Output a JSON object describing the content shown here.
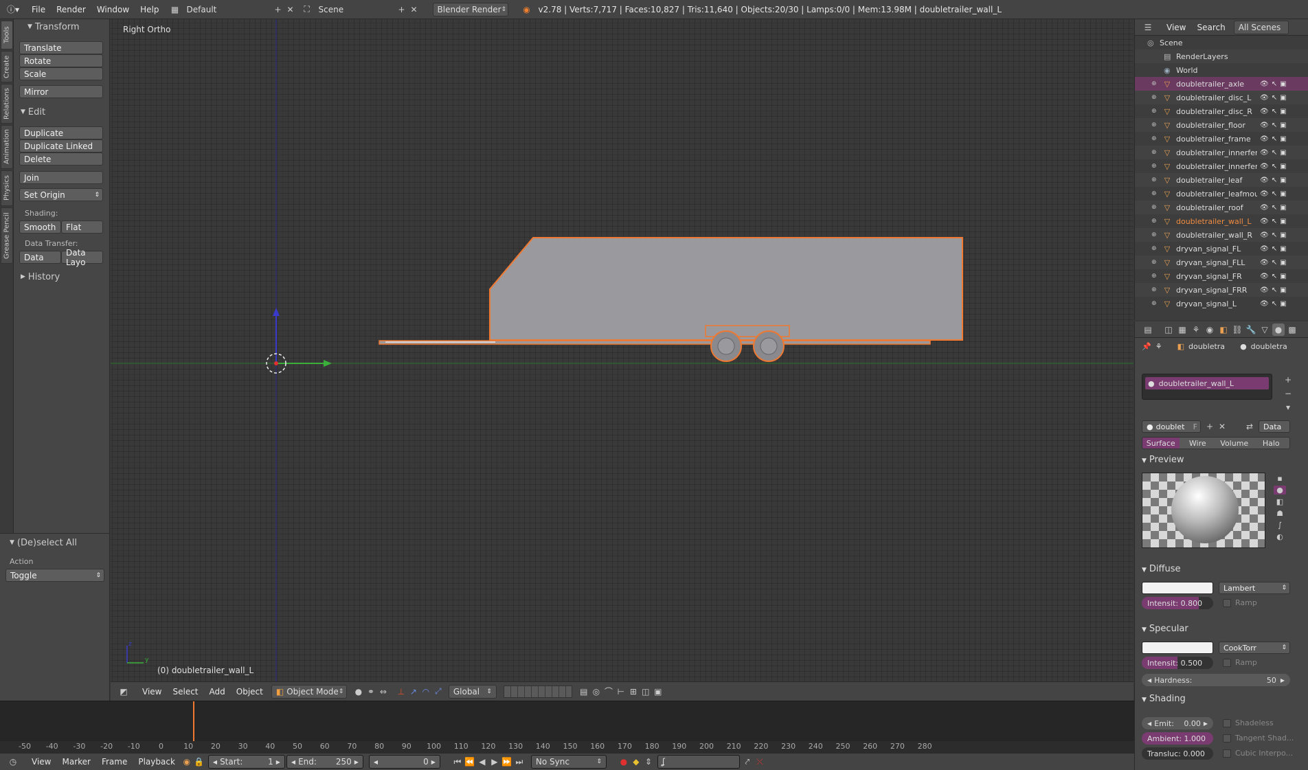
{
  "topbar": {
    "menus": [
      "File",
      "Render",
      "Window",
      "Help"
    ],
    "layout": "Default",
    "scene": "Scene",
    "engine": "Blender Render",
    "stats": "v2.78 | Verts:7,717 | Faces:10,827 | Tris:11,640 | Objects:20/30 | Lamps:0/0 | Mem:13.98M | doubletrailer_wall_L"
  },
  "tabs": [
    "Tools",
    "Create",
    "Relations",
    "Animation",
    "Physics",
    "Grease Pencil"
  ],
  "shelf": {
    "transform_title": "Transform",
    "translate": "Translate",
    "rotate": "Rotate",
    "scale": "Scale",
    "mirror": "Mirror",
    "edit_title": "Edit",
    "duplicate": "Duplicate",
    "duplicate_linked": "Duplicate Linked",
    "delete": "Delete",
    "join": "Join",
    "set_origin": "Set Origin",
    "shading_label": "Shading:",
    "smooth": "Smooth",
    "flat": "Flat",
    "data_transfer_label": "Data Transfer:",
    "data": "Data",
    "data_layo": "Data Layo",
    "history_title": "History"
  },
  "operator": {
    "title": "(De)select All",
    "action_label": "Action",
    "action_value": "Toggle"
  },
  "viewport": {
    "view_name": "Right Ortho",
    "object_info": "(0) doubletrailer_wall_L",
    "menus": [
      "View",
      "Select",
      "Add",
      "Object"
    ],
    "mode": "Object Mode",
    "orientation": "Global"
  },
  "outliner": {
    "menus": [
      "View",
      "Search"
    ],
    "filter": "All Scenes",
    "scene": "Scene",
    "renderlayers": "RenderLayers",
    "world": "World",
    "objects": [
      "doubletrailer_axle",
      "doubletrailer_disc_L",
      "doubletrailer_disc_R",
      "doubletrailer_floor",
      "doubletrailer_frame",
      "doubletrailer_innerfende",
      "doubletrailer_innerfende",
      "doubletrailer_leaf",
      "doubletrailer_leafmount",
      "doubletrailer_roof",
      "doubletrailer_wall_L",
      "doubletrailer_wall_R",
      "dryvan_signal_FL",
      "dryvan_signal_FLL",
      "dryvan_signal_FR",
      "dryvan_signal_FRR",
      "dryvan_signal_L"
    ]
  },
  "properties": {
    "context_obj": "doubletra",
    "context_mat": "doubletra",
    "material_slot": "doubletrailer_wall_L",
    "mat_field": "doublet",
    "mat_f": "F",
    "link": "Data",
    "tabs": [
      "Surface",
      "Wire",
      "Volume",
      "Halo"
    ],
    "preview_title": "Preview",
    "diffuse_title": "Diffuse",
    "diffuse_shader": "Lambert",
    "diffuse_intensity": "Intensit:  0.800",
    "ramp": "Ramp",
    "specular_title": "Specular",
    "specular_shader": "CookTorr",
    "specular_intensity": "Intensit:  0.500",
    "hardness": "Hardness:",
    "hardness_value": "50",
    "shading_title": "Shading",
    "emit": "Emit:",
    "emit_value": "0.00",
    "ambient": "Ambient: 1.000",
    "transluc": "Transluc: 0.000",
    "shadeless": "Shadeless",
    "tangent": "Tangent Shad...",
    "cubic": "Cubic Interpo..."
  },
  "timeline": {
    "ticks": [
      "-50",
      "-40",
      "-30",
      "-20",
      "-10",
      "0",
      "10",
      "20",
      "30",
      "40",
      "50",
      "60",
      "70",
      "80",
      "90",
      "100",
      "110",
      "120",
      "130",
      "140",
      "150",
      "160",
      "170",
      "180",
      "190",
      "200",
      "210",
      "220",
      "230",
      "240",
      "250",
      "260",
      "270",
      "280"
    ],
    "menus": [
      "View",
      "Marker",
      "Frame",
      "Playback"
    ],
    "start_label": "Start:",
    "start_value": "1",
    "end_label": "End:",
    "end_value": "250",
    "current": "0",
    "sync": "No Sync"
  },
  "colors": {
    "selection_orange": "#f07830",
    "accent_purple": "#7a3c70",
    "x_axis": "#3a9a3a",
    "z_axis": "#3a3aaa"
  }
}
